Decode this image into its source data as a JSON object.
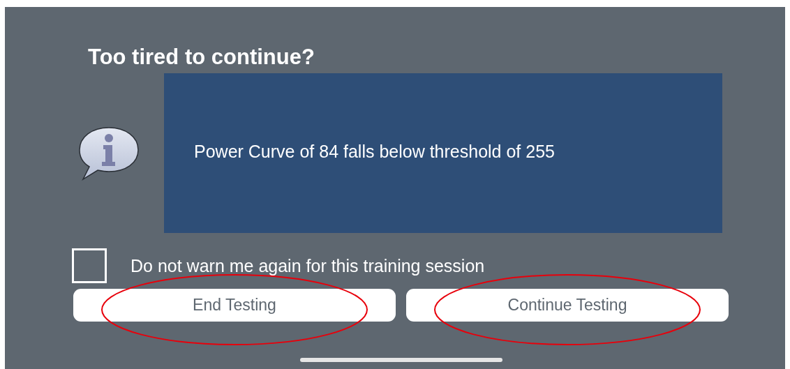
{
  "dialog": {
    "title": "Too tired to continue?",
    "message": "Power Curve of 84 falls below threshold of 255",
    "checkbox": {
      "label": "Do not warn me again for this training session",
      "checked": false
    },
    "buttons": [
      {
        "label": "End Testing",
        "circled": true
      },
      {
        "label": "Continue Testing",
        "circled": true
      }
    ]
  }
}
